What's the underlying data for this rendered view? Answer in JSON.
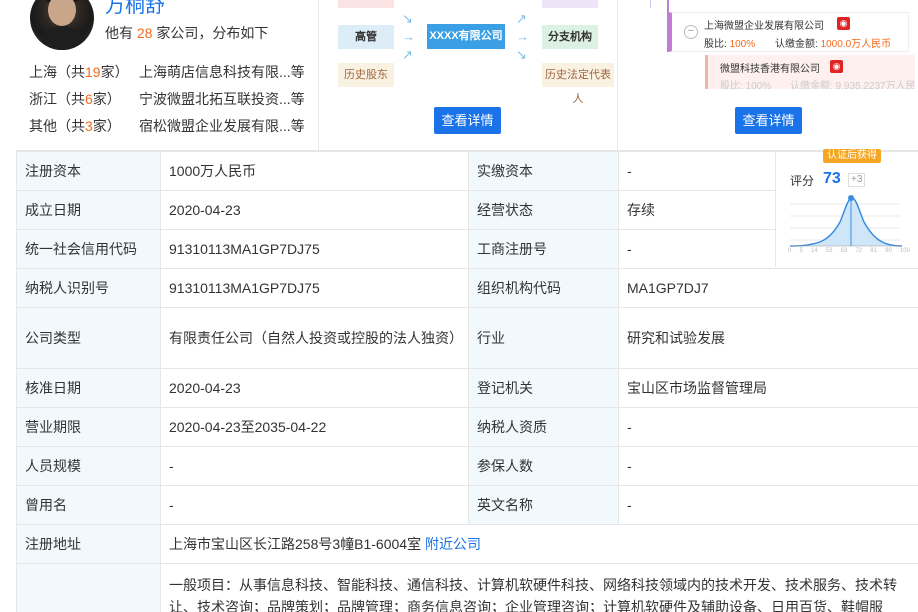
{
  "person": {
    "name": "万桐舒",
    "summary_pre": "他有",
    "count": "28",
    "summary_post": "家公司，分布如下"
  },
  "regions": [
    {
      "name": "上海",
      "open": "（共",
      "count": "19",
      "close": "家）",
      "company": "上海萌店信息科技有限...",
      "suffix": "等"
    },
    {
      "name": "浙江",
      "open": "（共",
      "count": "6",
      "close": "家）",
      "company": "宁波微盟北拓互联投资...",
      "suffix": "等"
    },
    {
      "name": "其他",
      "open": "（共",
      "count": "3",
      "close": "家）",
      "company": "宿松微盟企业发展有限...",
      "suffix": "等"
    }
  ],
  "diagram": {
    "left_mid": "高管",
    "center": "XXXX有限公司",
    "right_mid": "分支机构",
    "left_bottom": "历史股东",
    "right_bottom": "历史法定代表人",
    "button": "查看详情"
  },
  "equity": {
    "item1": {
      "name": "上海微盟企业发展有限公司",
      "ratio_label": "股比:",
      "ratio": "100%",
      "amount_label": "认缴金额:",
      "amount": "1000.0万人民币"
    },
    "item2": {
      "name": "微盟科技香港有限公司",
      "ratio_label": "股比:",
      "ratio": "100%",
      "amount_label": "认缴金额:",
      "amount": "9,935.2237万人民"
    },
    "button": "查看详情"
  },
  "score": {
    "badge": "认证后获得",
    "label": "评分",
    "value": "73",
    "plus": "+3",
    "axis": [
      "0",
      "5",
      "14",
      "53",
      "63",
      "72",
      "81",
      "90",
      "100"
    ]
  },
  "table": {
    "reg_capital": {
      "label": "注册资本",
      "value": "1000万人民币"
    },
    "paid_capital": {
      "label": "实缴资本",
      "value": "-"
    },
    "found_date": {
      "label": "成立日期",
      "value": "2020-04-23"
    },
    "status": {
      "label": "经营状态",
      "value": "存续"
    },
    "credit_code": {
      "label": "统一社会信用代码",
      "value": "91310113MA1GP7DJ75"
    },
    "biz_reg_no": {
      "label": "工商注册号",
      "value": "-"
    },
    "taxpayer_id": {
      "label": "纳税人识别号",
      "value": "91310113MA1GP7DJ75"
    },
    "org_code": {
      "label": "组织机构代码",
      "value": "MA1GP7DJ7"
    },
    "company_type": {
      "label": "公司类型",
      "value": "有限责任公司（自然人投资或控股的法人独资）"
    },
    "industry": {
      "label": "行业",
      "value": "研究和试验发展"
    },
    "approve_date": {
      "label": "核准日期",
      "value": "2020-04-23"
    },
    "reg_authority": {
      "label": "登记机关",
      "value": "宝山区市场监督管理局"
    },
    "term": {
      "label": "营业期限",
      "value": "2020-04-23至2035-04-22"
    },
    "tax_quality": {
      "label": "纳税人资质",
      "value": "-"
    },
    "staff_size": {
      "label": "人员规模",
      "value": "-"
    },
    "insured": {
      "label": "参保人数",
      "value": "-"
    },
    "former_name": {
      "label": "曾用名",
      "value": "-"
    },
    "english_name": {
      "label": "英文名称",
      "value": "-"
    },
    "address": {
      "label": "注册地址",
      "value": "上海市宝山区长江路258号3幢B1-6004室",
      "link": "附近公司"
    },
    "scope": {
      "value": "一般项目：从事信息科技、智能科技、通信科技、计算机软硬件科技、网络科技领域内的技术开发、技术服务、技术转让、技术咨询；品牌策划；品牌管理；商务信息咨询；企业管理咨询；计算机软硬件及辅助设备、日用百货、鞋帽服饰、"
    }
  }
}
